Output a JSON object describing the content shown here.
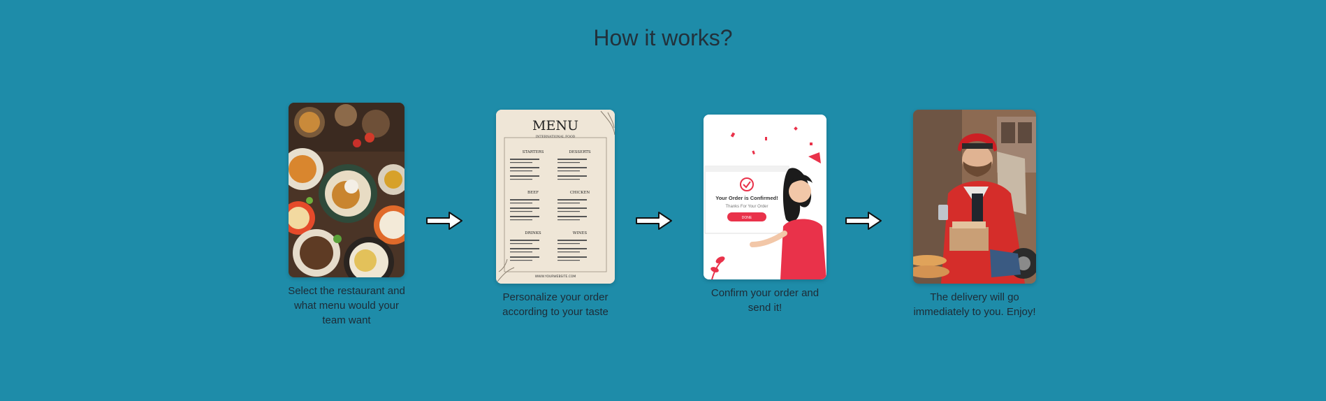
{
  "section": {
    "title": "How it works?"
  },
  "steps": [
    {
      "caption_lines": [
        "Select the restaurant and",
        "what menu would your",
        "team want"
      ],
      "image": "restaurant-food-table"
    },
    {
      "caption_lines": [
        "Personalize your order",
        "according to your taste"
      ],
      "image": "printed-menu",
      "menu": {
        "heading": "MENU",
        "subheading": "INTERNATIONAL FOOD",
        "sections": [
          "STARTERS",
          "DESSERTS",
          "BEEF",
          "CHICKEN",
          "DRINKS",
          "WINES"
        ],
        "footer": "WWW.YOURWEBSITE.COM"
      }
    },
    {
      "caption_lines": [
        "Confirm your order and",
        "send it!"
      ],
      "image": "order-confirmed-illustration",
      "confirmation": {
        "headline": "Your Order is Confirmed!",
        "subline": "Thanks For Your Order",
        "button": "DONE"
      }
    },
    {
      "caption_lines": [
        "The delivery will go",
        "immediately to you. Enjoy!"
      ],
      "image": "delivery-courier-scooter"
    }
  ],
  "arrows": [
    "arrow-right-icon",
    "arrow-right-icon",
    "arrow-right-icon"
  ],
  "colors": {
    "background": "#1e8ca9",
    "title": "#22313b",
    "caption": "#1d2b36",
    "accent_red": "#e9324a"
  }
}
